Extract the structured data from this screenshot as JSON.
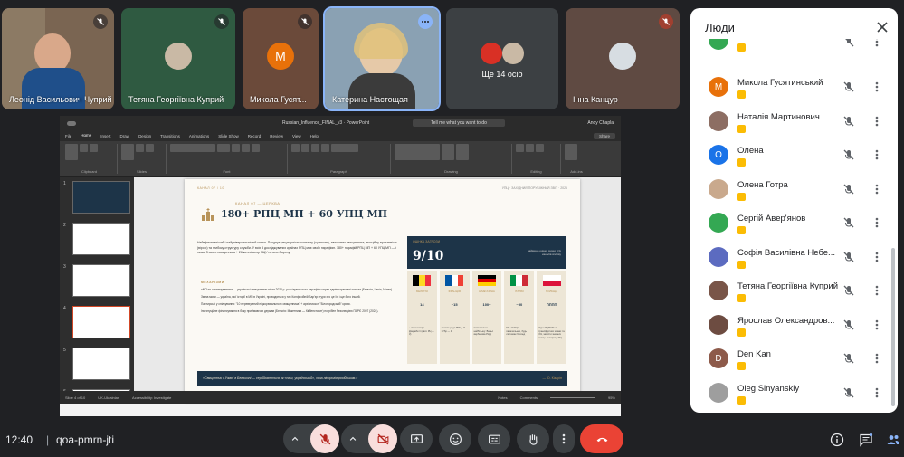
{
  "tiles": [
    {
      "name": "Леонід Васильович Чуприй",
      "type": "video",
      "muted": true,
      "bg": "#6d5a47"
    },
    {
      "name": "Тетяна Георгіївна Куприй",
      "type": "photo",
      "muted": true,
      "bg": "#2f5a41"
    },
    {
      "name": "Микола Гусят...",
      "type": "letter",
      "letter": "M",
      "muted": true,
      "bg": "#6b4a3a",
      "avatar_color": "#e8710a"
    },
    {
      "name": "Катерина Настощая",
      "type": "video",
      "muted": false,
      "bg": "#5d7388"
    },
    {
      "name": "Ще 14 осіб",
      "type": "group",
      "muted": false,
      "bg": "#3c4043"
    },
    {
      "name": "Інна Канцур",
      "type": "photo",
      "muted": true,
      "bg": "#5f4a42"
    }
  ],
  "ppt": {
    "title": "Russian_Influence_FINAL_v3 · PowerPoint",
    "user": "Andy Chapla",
    "search": "Tell me what you want to do",
    "tabs": [
      "File",
      "Home",
      "Insert",
      "Draw",
      "Design",
      "Transitions",
      "Animations",
      "Slide Show",
      "Record",
      "Review",
      "View",
      "Help"
    ],
    "active_tab": "Home",
    "share": "Share",
    "groups": [
      "Clipboard",
      "Slides",
      "Font",
      "Paragraph",
      "Drawing",
      "Editing",
      "Add-ins"
    ],
    "status": [
      "Slide 4 of 10",
      "UK-Ukrainian",
      "Accessibility: Investigate",
      "Notes",
      "Comments",
      "95%"
    ]
  },
  "slide": {
    "kicker": "КАНАЛ 07 / 10",
    "right_header": "УПЦ · ЗАХІДНИЙ ПОРУБІЖНИЙ ЗВІТ · 2026",
    "subtitle": "КАНАЛ 07 — ЦЕРКВА",
    "title": "180+ РПЦ МП + 60 УПЦ МП",
    "paragraph": "Найефективніший і найуніверсальніший канал. Поєднує регулярність контакту (щотижня), авторитет священника, емоційну вразливість (вірою) та глибоку структуру служби. У всіх 5 досліджуваних країнах РПЦ має своїх парафіян. 180+ парафій РПЦ МП + 60 УПЦ МП — і лише 3 свого священника + 26 катехізатор ПЦУ на всю Європу.",
    "mech_title": "МЕХАНІЗМИ",
    "mechanisms": [
      "«МП по замовчуванню» — українські священники після 2022 р. розсілуються по парафіях через адміністративні канали (Бельгія, Чехія, Мілан).",
      "Зміна мови — україна, мої історії в МП в Україні, проводяться у тих Конфесійній Бар'єр: тури хто це їх, і ще його інший.",
      "Пастирські у спілкування: \"10 переведений підкорювального священника\" + архієпископ \"Білогородській\" кризи.",
      "Інституційне фінансування в боку приймаючих держав (Бельгія: Міжетника — Кігбенстатит) потрібен Резолюцією ПАРЄ 2007 (2024)."
    ],
    "score_label": "ОЦІНКА ЗАГРОЗИ",
    "score": "9/10",
    "score_note": "найвища оцінка серед усіх каналів впливу",
    "countries": [
      {
        "name": "БЕЛЬГІЯ",
        "num": "14",
        "text": "+ 2 монастирі Дзержбетт (свят. РЦ —3)",
        "stripes": [
          "#000000",
          "#fdda24",
          "#ef3340"
        ],
        "vertical": true
      },
      {
        "name": "ФРАНЦІЯ",
        "num": "~15",
        "text": "Велика рада РПЦ + Є. Ю'бр — 3",
        "stripes": [
          "#0055a4",
          "#ffffff",
          "#ef4135"
        ],
        "vertical": true
      },
      {
        "name": "НІМЕЧЧИНА",
        "num": "100+",
        "text": "Статистично найбільшу: Вальс вербалова РЦЦ",
        "stripes": [
          "#000000",
          "#dd0000",
          "#ffce00"
        ],
        "vertical": false
      },
      {
        "name": "ІТАЛІЯ",
        "num": "~50",
        "text": "50+ 10 РЦЦ паралельних, будь системах безлюд",
        "stripes": [
          "#009246",
          "#ffffff",
          "#ce2b37"
        ],
        "vertical": true
      },
      {
        "name": "ПОЛЬЩА",
        "num": "ПППП",
        "text": "Одна ПЦМУП на трансфертних мовах та 1%, захисти значних голиць реєстрації РЦ",
        "stripes": [
          "#ffffff",
          "#dc143c"
        ],
        "vertical": false
      }
    ],
    "quote": "«Священник з Ужані в Белжичні — серййозняться як «наш, український», хоча ліпорогів російським.»",
    "quote_source": "— Ю. Кізарін"
  },
  "people": {
    "title": "Люди",
    "list": [
      {
        "name": "Микола Гусятинський",
        "letter": "M",
        "color": "#e8710a"
      },
      {
        "name": "Наталія Мартинович",
        "letter": "",
        "color": "#8d6e63"
      },
      {
        "name": "Олена",
        "letter": "О",
        "color": "#1a73e8"
      },
      {
        "name": "Олена Готра",
        "letter": "",
        "color": "#c9a98d"
      },
      {
        "name": "Сергій Авер'янов",
        "letter": "",
        "color": "#34a853"
      },
      {
        "name": "Софія Василівна Небе...",
        "letter": "",
        "color": "#5c6bc0"
      },
      {
        "name": "Тетяна Георгіївна Куприй",
        "letter": "",
        "color": "#795548"
      },
      {
        "name": "Ярослав Олександров...",
        "letter": "",
        "color": "#6d4c41"
      },
      {
        "name": "Den Kan",
        "letter": "D",
        "color": "#8d5a4a"
      },
      {
        "name": "Oleg Sinyanskiy",
        "letter": "",
        "color": "#9e9e9e"
      }
    ]
  },
  "meeting": {
    "time": "12:40",
    "separator": "|",
    "code": "qoa-pmrn-jti"
  }
}
